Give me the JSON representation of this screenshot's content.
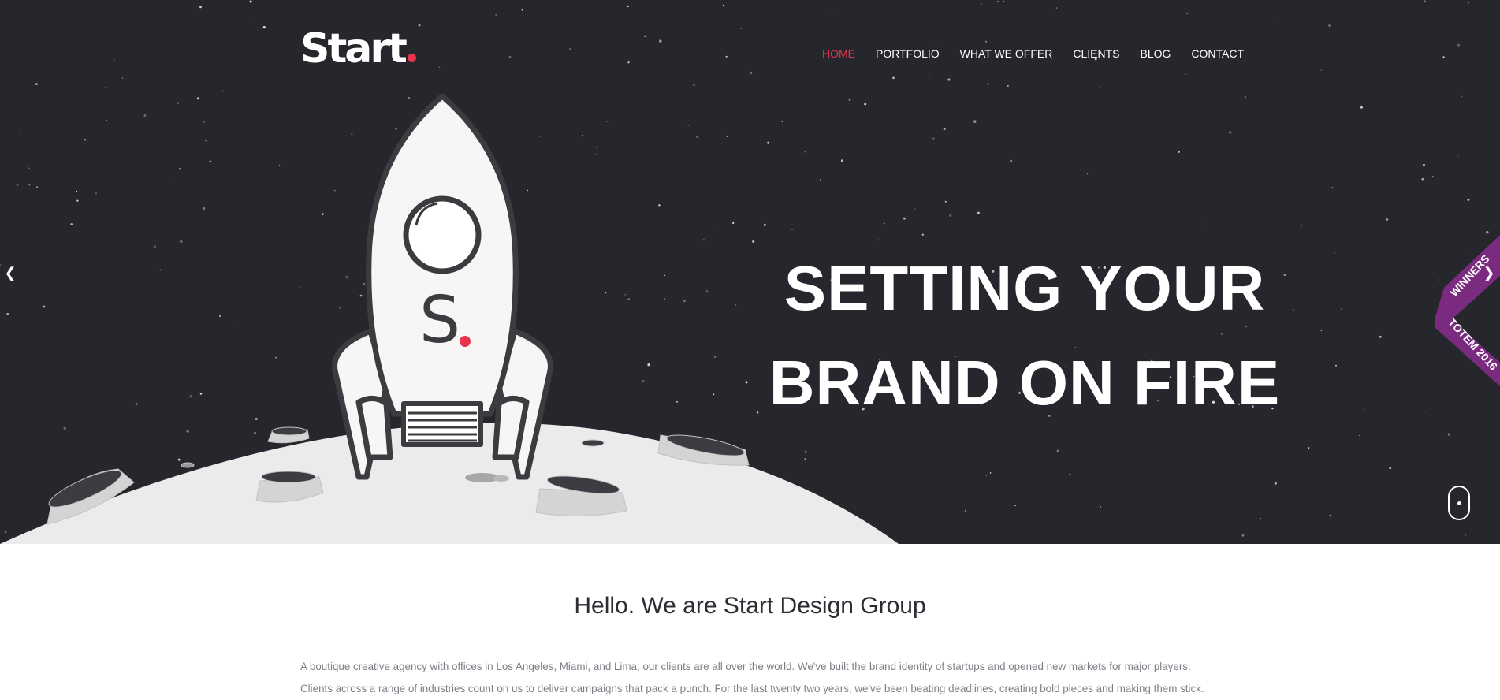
{
  "header": {
    "logo_text": "Start",
    "nav": [
      {
        "label": "HOME",
        "active": true
      },
      {
        "label": "PORTFOLIO",
        "active": false
      },
      {
        "label": "WHAT WE OFFER",
        "active": false
      },
      {
        "label": "CLIENTS",
        "active": false
      },
      {
        "label": "BLOG",
        "active": false
      },
      {
        "label": "CONTACT",
        "active": false
      }
    ]
  },
  "hero": {
    "headline_line1": "SETTING YOUR",
    "headline_line2": "BRAND ON FIRE",
    "rocket_letter": "S",
    "prev_icon": "chevron-left-icon",
    "next_icon": "chevron-right-icon",
    "scroll_icon": "mouse-scroll-icon"
  },
  "ribbon": {
    "line1": "WINNERS",
    "line2": "TOTEM 2016"
  },
  "about": {
    "title": "Hello. We are Start Design Group",
    "paragraph_line1": "A boutique creative agency with offices in Los Angeles, Miami, and Lima; our clients are all over the world. We've built the brand identity of startups and opened new markets for major players.",
    "paragraph_line2": "Clients across a range of industries count on us to deliver campaigns that pack a punch. For the last twenty two years, we've been beating deadlines, creating bold pieces and making them stick."
  },
  "colors": {
    "hero_bg": "#25272d",
    "accent": "#e7334b",
    "ribbon": "#7a2a7f",
    "moon": "#ebebeb"
  }
}
